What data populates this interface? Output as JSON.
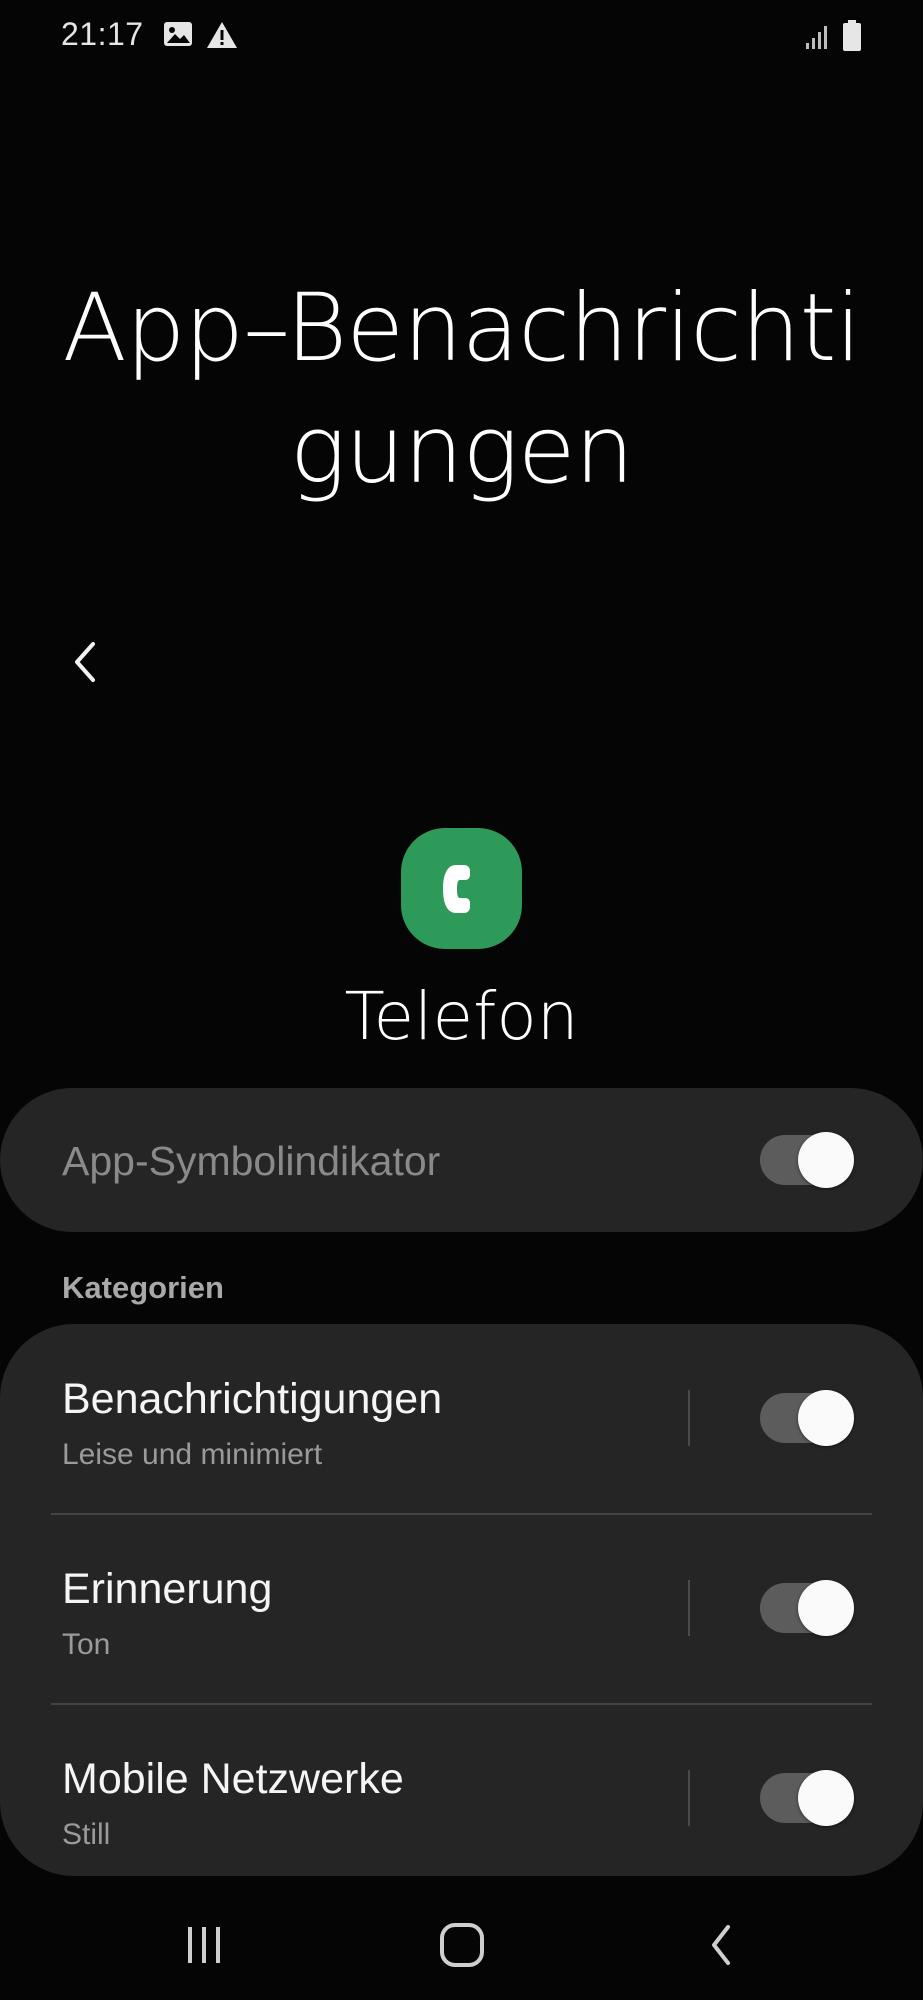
{
  "status_bar": {
    "time": "21:17",
    "icons": [
      "image-icon",
      "warning-icon",
      "signal-icon",
      "battery-icon"
    ]
  },
  "header": {
    "title_line1": "App–Benachrichti",
    "title_line2": "gungen",
    "back_icon": "chevron-left-icon"
  },
  "app": {
    "name": "Telefon",
    "icon": "phone-app-icon",
    "icon_color": "#2e9a5a"
  },
  "badge": {
    "label": "App-Symbolindikator",
    "enabled": true
  },
  "categories": {
    "header": "Kategorien",
    "items": [
      {
        "title": "Benachrichtigungen",
        "subtitle": "Leise und minimiert",
        "enabled": true
      },
      {
        "title": "Erinnerung",
        "subtitle": "Ton",
        "enabled": true
      },
      {
        "title": "Mobile Netzwerke",
        "subtitle": "Still",
        "enabled": true
      }
    ]
  },
  "nav_bar": {
    "buttons": [
      "recent-apps-icon",
      "home-icon",
      "back-icon"
    ]
  },
  "colors": {
    "background": "#050505",
    "card": "#252525",
    "toggle_track": "#5c5c5c",
    "toggle_knob": "#fafafa"
  }
}
